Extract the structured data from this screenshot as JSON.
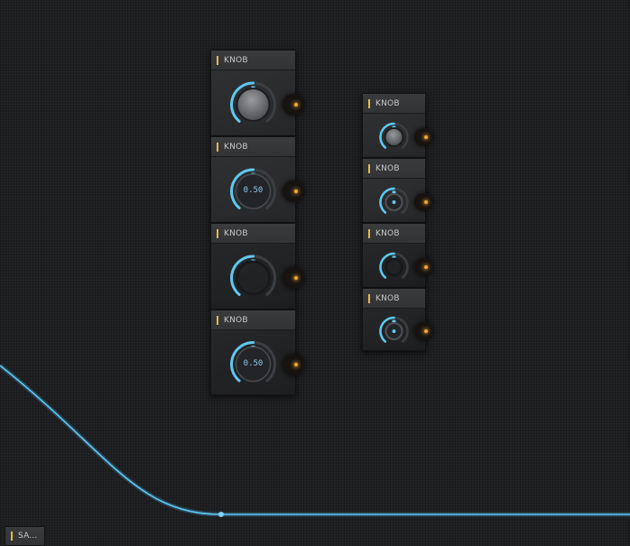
{
  "colors": {
    "accent": "#e6b84c",
    "wire": "#4cb8f0",
    "knob_arc": "#5ec8f0",
    "port_dot": "#f0a830"
  },
  "nodes": [
    {
      "title": "KNOB",
      "value": 0.5,
      "value_text": "",
      "style": "solid",
      "body": "light"
    },
    {
      "title": "KNOB",
      "value": 0.5,
      "value_text": "0.50",
      "style": "labeled",
      "body": "light"
    },
    {
      "title": "KNOB",
      "value": 0.5,
      "value_text": "",
      "style": "ring",
      "body": "dark"
    },
    {
      "title": "KNOB",
      "value": 0.5,
      "value_text": "0.50",
      "style": "labeled",
      "body": "dark"
    },
    {
      "title": "KNOB",
      "value": 0.5,
      "value_text": "",
      "style": "solid",
      "body": "light"
    },
    {
      "title": "KNOB",
      "value": 0.5,
      "value_text": "",
      "style": "dot",
      "body": "light"
    },
    {
      "title": "KNOB",
      "value": 0.5,
      "value_text": "",
      "style": "ring",
      "body": "dark"
    },
    {
      "title": "KNOB",
      "value": 0.5,
      "value_text": "",
      "style": "dot",
      "body": "dark"
    }
  ],
  "sa_node": {
    "title": "SA..."
  }
}
